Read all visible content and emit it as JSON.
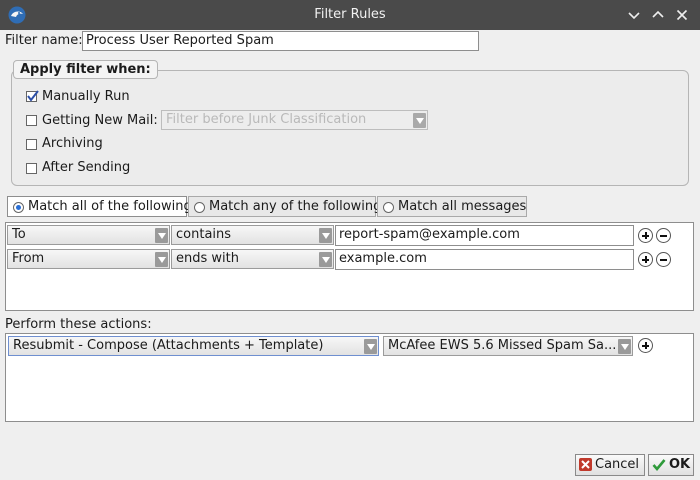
{
  "window": {
    "title": "Filter Rules"
  },
  "filter_name": {
    "label": "Filter name:",
    "value": "Process User Reported Spam"
  },
  "apply_when": {
    "legend": "Apply filter when:",
    "options": [
      {
        "label": "Manually Run",
        "checked": true
      },
      {
        "label": "Getting New Mail:",
        "checked": false
      },
      {
        "label": "Archiving",
        "checked": false
      },
      {
        "label": "After Sending",
        "checked": false
      }
    ],
    "new_mail_combo": "Filter before Junk Classification"
  },
  "match": {
    "options": [
      {
        "label": "Match all of the following",
        "selected": true
      },
      {
        "label": "Match any of the following",
        "selected": false
      },
      {
        "label": "Match all messages",
        "selected": false
      }
    ]
  },
  "rules": [
    {
      "field": "To",
      "operator": "contains",
      "value": "report-spam@example.com"
    },
    {
      "field": "From",
      "operator": "ends with",
      "value": "example.com"
    }
  ],
  "actions": {
    "label": "Perform these actions:",
    "items": [
      {
        "action": "Resubmit - Compose (Attachments + Template)",
        "target": "McAfee EWS 5.6 Missed Spam Sa..."
      }
    ]
  },
  "buttons": {
    "cancel": "Cancel",
    "ok": "OK"
  }
}
